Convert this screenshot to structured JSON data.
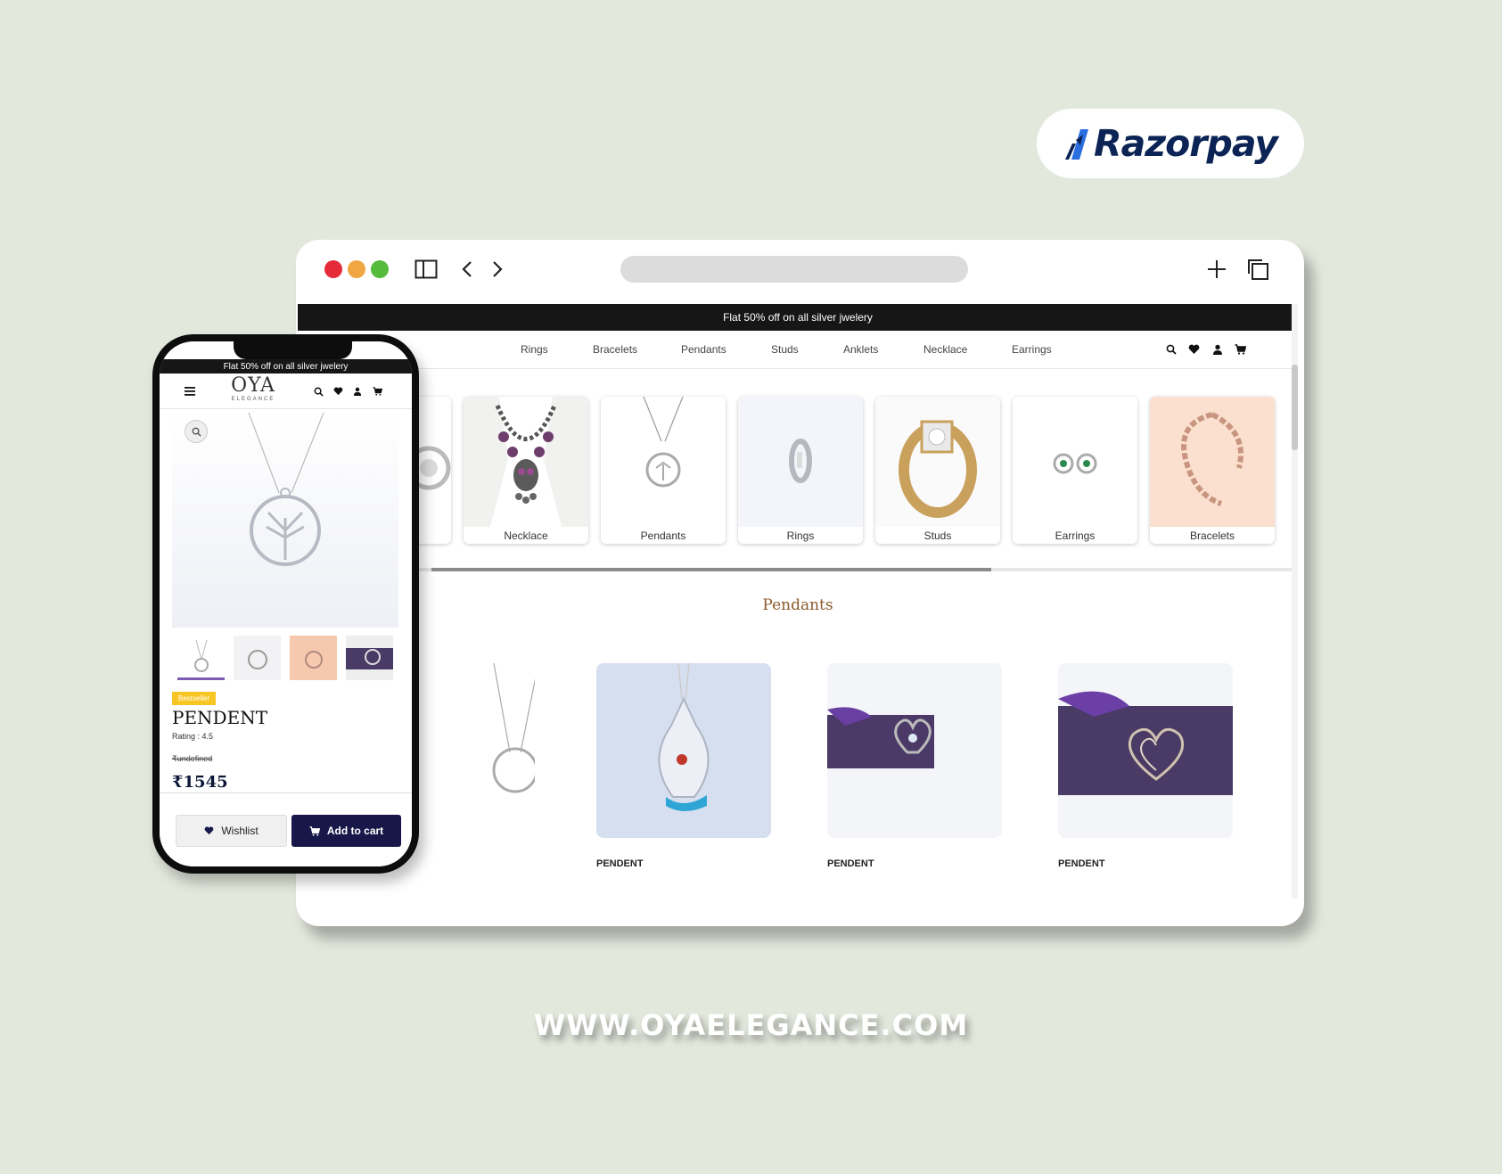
{
  "brand_badge": {
    "name": "Razorpay",
    "logo_icon": "razorpay-logo-icon"
  },
  "browser": {
    "window_controls": [
      "close",
      "minimize",
      "maximize"
    ],
    "promo_banner": "Flat 50% off on all silver jwelery",
    "nav": {
      "items": [
        "Rings",
        "Bracelets",
        "Pendants",
        "Studs",
        "Anklets",
        "Necklace",
        "Earrings"
      ],
      "icons": [
        "search-icon",
        "heart-icon",
        "user-icon",
        "cart-icon"
      ]
    },
    "categories": [
      {
        "label": "Necklace"
      },
      {
        "label": "Pendants"
      },
      {
        "label": "Rings"
      },
      {
        "label": "Studs"
      },
      {
        "label": "Earrings"
      },
      {
        "label": "Bracelets"
      }
    ],
    "section": {
      "title": "Pendants",
      "products": [
        {
          "name": "PENDENT"
        },
        {
          "name": "PENDENT"
        },
        {
          "name": "PENDENT"
        }
      ]
    }
  },
  "mobile": {
    "promo_banner": "Flat 50% off on all silver jwelery",
    "logo": {
      "main": "OYA",
      "sub": "ELEGANCE"
    },
    "product": {
      "badge": "Bestseller",
      "title": "PENDENT",
      "rating": "Rating : 4.5",
      "old_price": "₹undefined",
      "price": "₹1545"
    },
    "buttons": {
      "wishlist": "Wishlist",
      "add_to_cart": "Add to cart"
    }
  },
  "website_url": "WWW.OYAELEGANCE.COM",
  "colors": {
    "background": "#e3e8dd",
    "brand_navy": "#17174a",
    "section_title": "#8b5a2b",
    "badge": "#f7c624"
  }
}
